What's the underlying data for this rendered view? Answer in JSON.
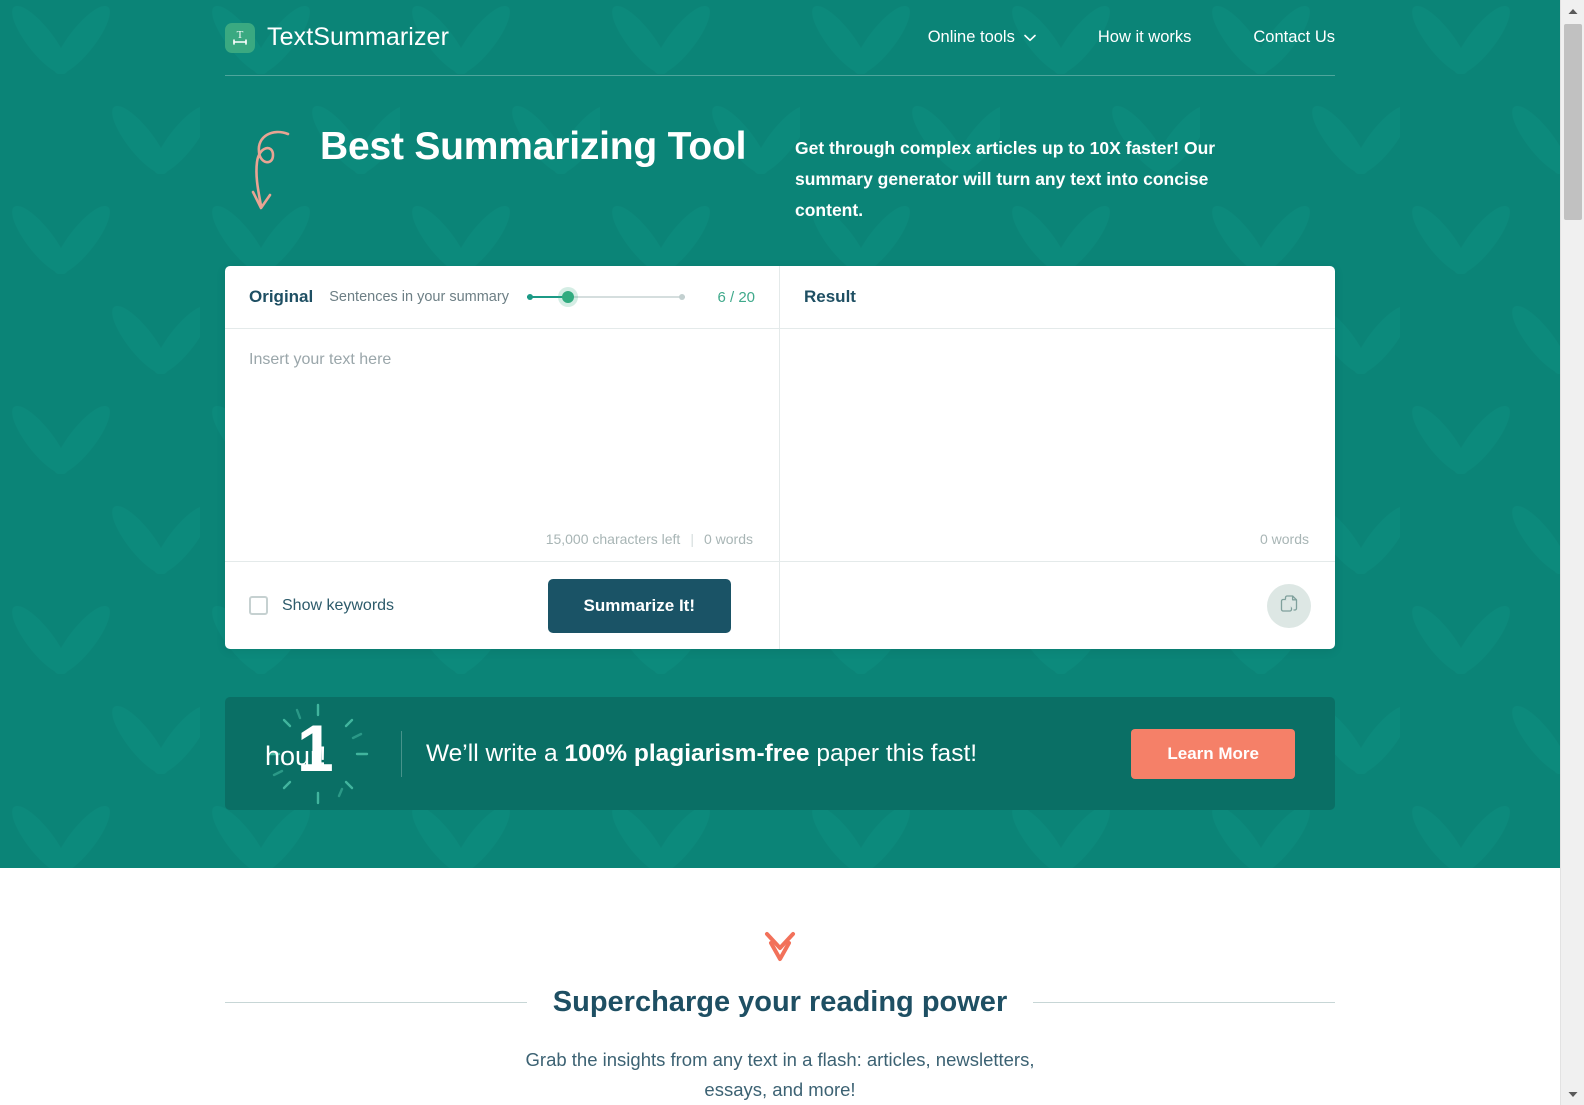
{
  "header": {
    "brand_name": "TextSummarizer",
    "logo_icon": "text-summarizer-logo-icon",
    "nav": [
      {
        "label": "Online tools",
        "has_caret": true,
        "icon": "chevron-down-icon"
      },
      {
        "label": "How it works",
        "has_caret": false
      },
      {
        "label": "Contact Us",
        "has_caret": false
      }
    ]
  },
  "hero": {
    "decoration_icon": "curly-arrow-icon",
    "title": "Best Summarizing Tool",
    "description": "Get through complex articles up to 10X faster! Our summary generator will turn any text into concise content."
  },
  "tool": {
    "original": {
      "title": "Original",
      "slider_label": "Sentences in your summary",
      "slider_value": 6,
      "slider_max": 20,
      "slider_count_text": "6 / 20",
      "slider_percent": 26,
      "textarea_placeholder": "Insert your text here",
      "textarea_value": "",
      "characters_left": "15,000 characters left",
      "meta_separator": "|",
      "word_count": "0 words",
      "show_keywords_label": "Show keywords",
      "show_keywords_checked": false,
      "summarize_button": "Summarize It!"
    },
    "result": {
      "title": "Result",
      "content": "",
      "word_count": "0 words",
      "copy_icon": "copy-icon"
    }
  },
  "promo": {
    "badge_number": "1",
    "badge_unit": "hour!",
    "text_prefix": "We’ll write a ",
    "text_bold": "100% plagiarism-free",
    "text_suffix": " paper this fast!",
    "button_label": "Learn More"
  },
  "lower": {
    "chevron_icon": "double-chevron-down-icon",
    "section_title": "Supercharge your reading power",
    "section_subtitle": "Grab the insights from any text in a flash: articles, newsletters, essays, and more!"
  },
  "scrollbar": {
    "up_icon": "scroll-up-arrow-icon",
    "down_icon": "scroll-down-arrow-icon"
  },
  "colors": {
    "teal_bg": "#0b8477",
    "dark_teal": "#1a5366",
    "promo_bg": "#0a6f65",
    "coral": "#f58068",
    "green_accent": "#31ab7f",
    "heading_navy": "#1e4f63"
  }
}
